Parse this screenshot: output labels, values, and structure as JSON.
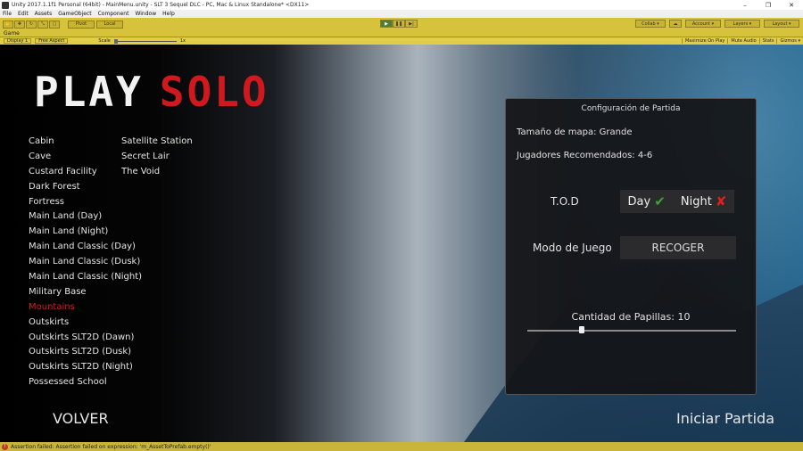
{
  "editor": {
    "window_title": "Unity 2017.1.1f1 Personal (64bit) - MainMenu.unity - SLT 3 Sequel DLC - PC, Mac & Linux Standalone* <DX11>",
    "window_controls": [
      "–",
      "❐",
      "✕"
    ],
    "menu": [
      "File",
      "Edit",
      "Assets",
      "GameObject",
      "Component",
      "Window",
      "Help"
    ],
    "toolbar": {
      "pivot": "Pivot",
      "local": "Local",
      "collab": "Collab ▾",
      "account": "Account ▾",
      "layers": "Layers ▾",
      "layout": "Layout ▾"
    },
    "game_tab": "Game",
    "game_bar": {
      "display": "Display 1",
      "aspect": "Free Aspect",
      "scale_label": "Scale",
      "scale_value": "1x",
      "toggles": [
        "Maximize On Play",
        "Mute Audio",
        "Stats",
        "Gizmos ▾"
      ]
    },
    "status_message": "Assertion failed: Assertion failed on expression: 'm_AssetToPrefab.empty()'"
  },
  "game": {
    "logo": {
      "word1": "PLAY",
      "word2": "SOLO"
    },
    "maps_col1": [
      "Cabin",
      "Cave",
      "Custard Facility",
      "Dark Forest",
      "Fortress",
      "Main Land (Day)",
      "Main Land (Night)",
      "Main Land Classic (Day)",
      "Main Land Classic (Dusk)",
      "Main Land Classic (Night)",
      "Military Base",
      "Mountains",
      "Outskirts",
      "Outskirts SLT2D (Dawn)",
      "Outskirts SLT2D (Dusk)",
      "Outskirts SLT2D (Night)",
      "Possessed School"
    ],
    "maps_col2": [
      "Satellite Station",
      "Secret Lair",
      "The Void"
    ],
    "selected_map": "Mountains",
    "config": {
      "title": "Configuración de Partida",
      "map_size": "Tamaño de mapa:  Grande",
      "recommended_players": "Jugadores Recomendados: 4-6",
      "tod_label": "T.O.D",
      "day_label": "Day",
      "night_label": "Night",
      "mode_label": "Modo de Juego",
      "mode_value": "RECOGER",
      "papillas": "Cantidad de Papillas: 10",
      "papillas_fraction": 0.26
    },
    "back_button": "VOLVER",
    "start_button": "Iniciar Partida"
  }
}
